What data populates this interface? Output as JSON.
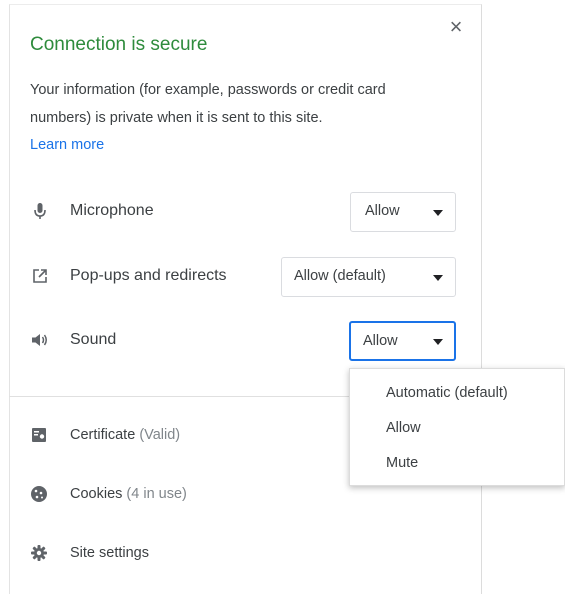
{
  "header": {
    "title": "Connection is secure",
    "description": "Your information (for example, passwords or credit card numbers) is private when it is sent to this site.",
    "learn_more": "Learn more",
    "close_icon": "close-icon"
  },
  "permissions": [
    {
      "label": "Microphone",
      "value": "Allow",
      "icon": "microphone-icon"
    },
    {
      "label": "Pop-ups and redirects",
      "value": "Allow (default)",
      "icon": "open-external-icon"
    },
    {
      "label": "Sound",
      "value": "Allow",
      "icon": "speaker-icon"
    }
  ],
  "sound_dropdown": {
    "options": [
      "Automatic (default)",
      "Allow",
      "Mute"
    ]
  },
  "footer": {
    "certificate": {
      "label": "Certificate",
      "sub": "(Valid)",
      "icon": "certificate-icon"
    },
    "cookies": {
      "label": "Cookies",
      "sub": "(4 in use)",
      "icon": "cookie-icon"
    },
    "site_settings": {
      "label": "Site settings",
      "icon": "gear-icon"
    }
  },
  "colors": {
    "title_green": "#2e8b3c",
    "link_blue": "#1a73e8",
    "focus_blue": "#1a73e8"
  }
}
